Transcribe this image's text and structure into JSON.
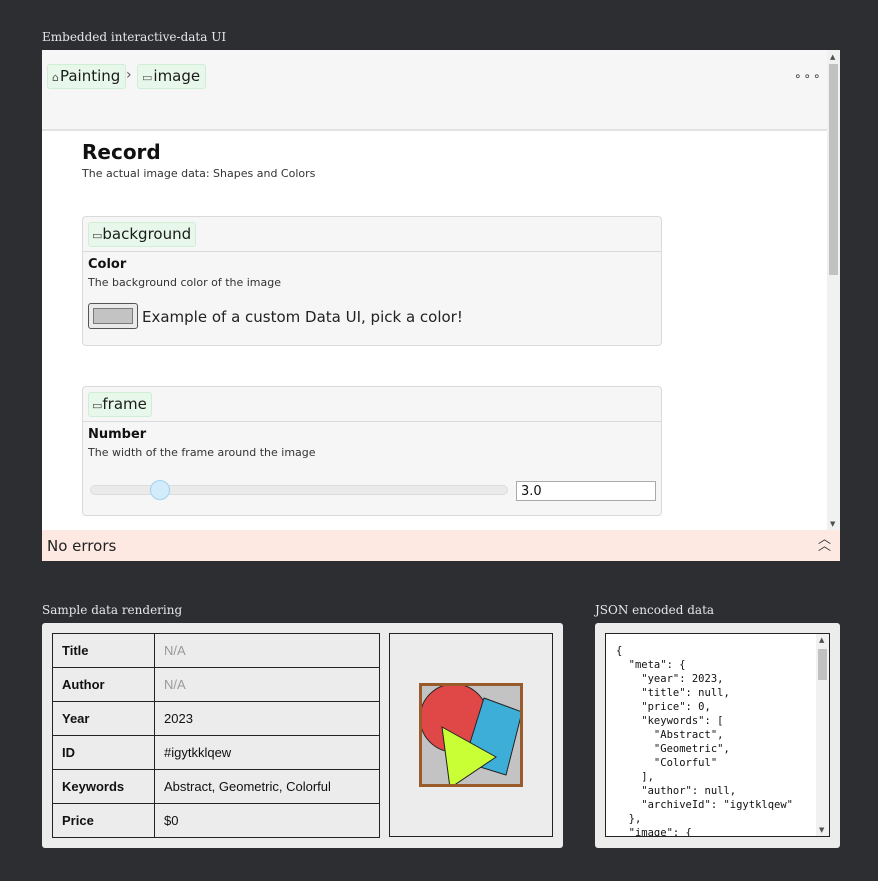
{
  "labels": {
    "embedded": "Embedded interactive-data UI",
    "sample": "Sample data rendering",
    "json": "JSON encoded data"
  },
  "breadcrumb": {
    "root": "Painting",
    "current": "image",
    "menu": "∘∘∘"
  },
  "record": {
    "title": "Record",
    "description": "The actual image data: Shapes and Colors"
  },
  "background_card": {
    "tag": "background",
    "field_title": "Color",
    "field_desc": "The background color of the image",
    "swatch_color": "#c3c3c3",
    "note": "Example of a custom Data UI, pick a color!"
  },
  "frame_card": {
    "tag": "frame",
    "field_title": "Number",
    "field_desc": "The width of the frame around the image",
    "value": "3.0"
  },
  "status": {
    "text": "No errors"
  },
  "sample_table": [
    {
      "key": "Title",
      "value": "N/A"
    },
    {
      "key": "Author",
      "value": "N/A"
    },
    {
      "key": "Year",
      "value": "2023"
    },
    {
      "key": "ID",
      "value": "#igytkklqew"
    },
    {
      "key": "Keywords",
      "value": "Abstract, Geometric, Colorful"
    },
    {
      "key": "Price",
      "value": "$0"
    }
  ],
  "painting": {
    "background": "#c3c3c3",
    "frame_color": "#9a5b2a",
    "shape_colors": [
      "#e04848",
      "#3caed7",
      "#c8ff35"
    ]
  },
  "json_text": "{\n  \"meta\": {\n    \"year\": 2023,\n    \"title\": null,\n    \"price\": 0,\n    \"keywords\": [\n      \"Abstract\",\n      \"Geometric\",\n      \"Colorful\"\n    ],\n    \"author\": null,\n    \"archiveId\": \"igytklqew\"\n  },\n  \"image\": {"
}
